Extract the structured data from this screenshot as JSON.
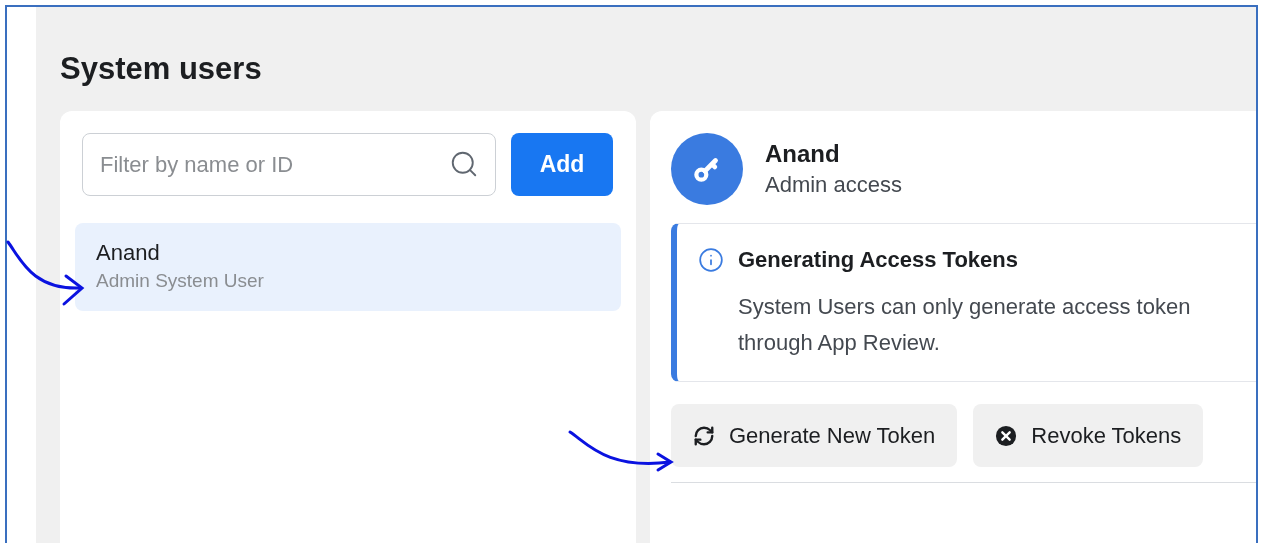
{
  "page": {
    "title": "System users"
  },
  "user_list": {
    "search": {
      "placeholder": "Filter by name or ID"
    },
    "add_button": "Add",
    "items": [
      {
        "name": "Anand",
        "role": "Admin System User",
        "selected": true
      }
    ]
  },
  "detail": {
    "name": "Anand",
    "access": "Admin access",
    "notice": {
      "title": "Generating Access Tokens",
      "text": "System Users can only generate access token through App Review."
    },
    "actions": [
      {
        "kind": "refresh",
        "label": "Generate New Token"
      },
      {
        "kind": "revoke",
        "label": "Revoke Tokens"
      }
    ]
  }
}
